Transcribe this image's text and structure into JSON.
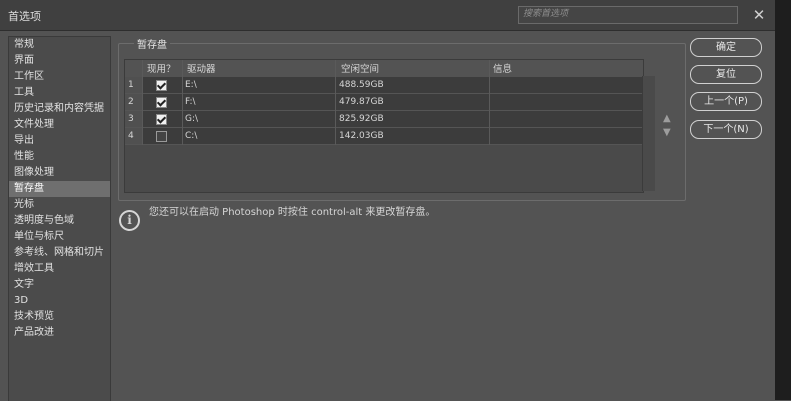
{
  "window": {
    "title": "首选项",
    "search_placeholder": "搜索首选项",
    "close_glyph": "✕"
  },
  "sidebar": {
    "items": [
      {
        "label": "常规"
      },
      {
        "label": "界面"
      },
      {
        "label": "工作区"
      },
      {
        "label": "工具"
      },
      {
        "label": "历史记录和内容凭据"
      },
      {
        "label": "文件处理"
      },
      {
        "label": "导出"
      },
      {
        "label": "性能"
      },
      {
        "label": "图像处理"
      },
      {
        "label": "暂存盘"
      },
      {
        "label": "光标"
      },
      {
        "label": "透明度与色域"
      },
      {
        "label": "单位与标尺"
      },
      {
        "label": "参考线、网格和切片"
      },
      {
        "label": "增效工具"
      },
      {
        "label": "文字"
      },
      {
        "label": "3D"
      },
      {
        "label": "技术预览"
      },
      {
        "label": "产品改进"
      }
    ],
    "selected_index": 9
  },
  "scratch": {
    "group_title": "暂存盘",
    "columns": {
      "active": "现用？",
      "drive": "驱动器",
      "free": "空闲空间",
      "info": "信息"
    },
    "rows": [
      {
        "index": "1",
        "checked": true,
        "drive": "E:\\",
        "free": "488.59GB",
        "info": ""
      },
      {
        "index": "2",
        "checked": true,
        "drive": "F:\\",
        "free": "479.87GB",
        "info": ""
      },
      {
        "index": "3",
        "checked": true,
        "drive": "G:\\",
        "free": "825.92GB",
        "info": ""
      },
      {
        "index": "4",
        "checked": false,
        "drive": "C:\\",
        "free": "142.03GB",
        "info": ""
      }
    ],
    "move_up_glyph": "▲",
    "move_down_glyph": "▼"
  },
  "buttons": {
    "ok": "确定",
    "reset": "复位",
    "prev": "上一个(P)",
    "next": "下一个(N)"
  },
  "info": {
    "icon": "i",
    "text": "您还可以在启动 Photoshop 时按住 control-alt 来更改暂存盘。"
  }
}
